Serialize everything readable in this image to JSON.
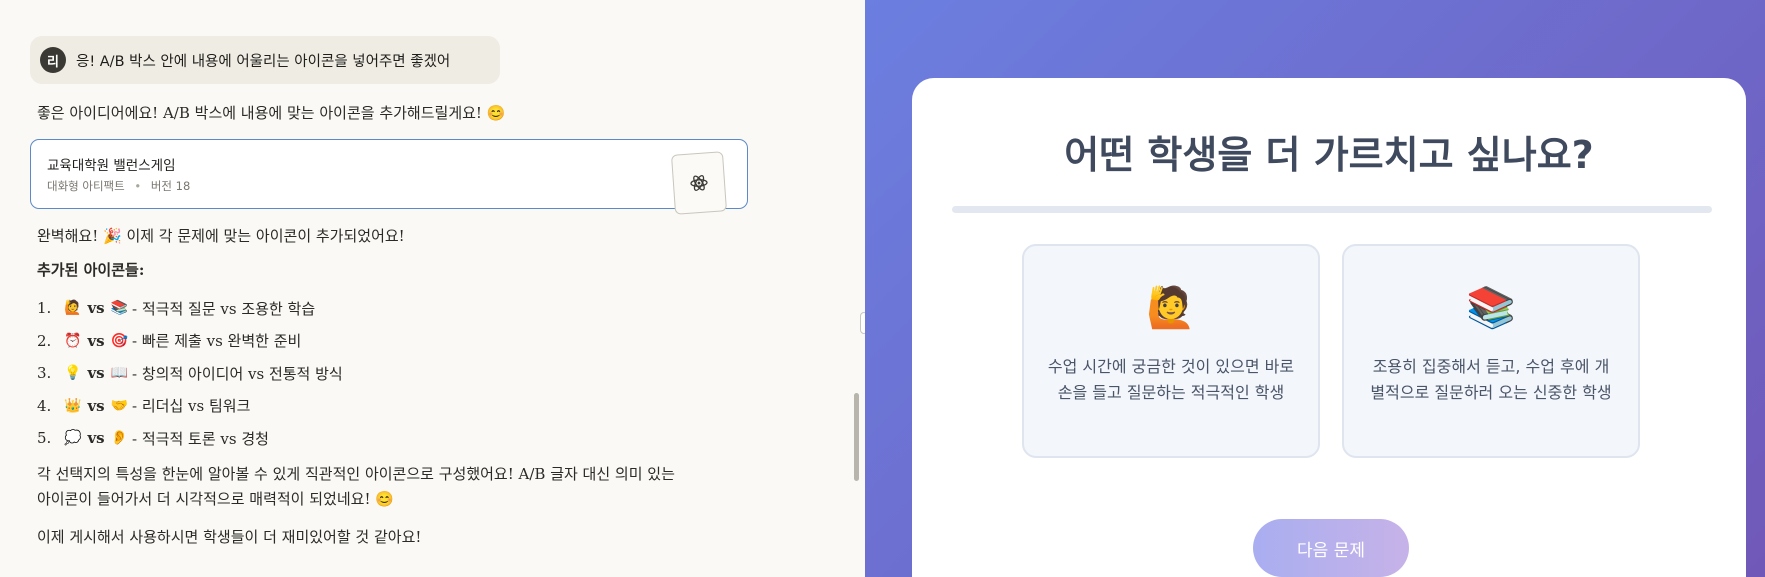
{
  "chat": {
    "user_avatar": "리",
    "user_message": "응! A/B 박스 안에 내용에 어울리는 아이콘을 넣어주면 좋겠어",
    "reply_intro": "좋은 아이디어에요! A/B 박스에 내용에 맞는 아이콘을 추가해드릴게요! 😊",
    "artifact": {
      "title": "교육대학원 밸런스게임",
      "type": "대화형 아티팩트",
      "separator": "•",
      "version": "버전 18",
      "thumb_icon": "atom-icon"
    },
    "done_text": "완벽해요! 🎉 이제 각 문제에 맞는 아이콘이 추가되었어요!",
    "added_heading": "추가된 아이콘들:",
    "list": [
      {
        "num": "1.",
        "a": "🙋",
        "vs": "vs",
        "b": "📚",
        "desc": "- 적극적 질문 vs 조용한 학습"
      },
      {
        "num": "2.",
        "a": "⏰",
        "vs": "vs",
        "b": "🎯",
        "desc": "- 빠른 제출 vs 완벽한 준비"
      },
      {
        "num": "3.",
        "a": "💡",
        "vs": "vs",
        "b": "📖",
        "desc": "- 창의적 아이디어 vs 전통적 방식"
      },
      {
        "num": "4.",
        "a": "👑",
        "vs": "vs",
        "b": "🤝",
        "desc": "- 리더십 vs 팀워크"
      },
      {
        "num": "5.",
        "a": "💭",
        "vs": "vs",
        "b": "👂",
        "desc": "- 적극적 토론 vs 경청"
      }
    ],
    "closing_line1": "각 선택지의 특성을 한눈에 알아볼 수 있게 직관적인 아이콘으로 구성했어요! A/B 글자 대신 의미 있는",
    "closing_line2": "아이콘이 들어가서 더 시각적으로 매력적이 되었네요! 😊",
    "final_line": "이제 게시해서 사용하시면 학생들이 더 재미있어할 것 같아요!"
  },
  "preview": {
    "question": "어떤 학생을 더 가르치고 싶나요?",
    "choice_a": {
      "icon": "🙋",
      "text": "수업 시간에 궁금한 것이 있으면 바로 손을 들고 질문하는 적극적인 학생"
    },
    "choice_b": {
      "icon": "📚",
      "text": "조용히 집중해서 듣고, 수업 후에 개별적으로 질문하러 오는 신중한 학생"
    },
    "next_label": "다음 문제"
  }
}
